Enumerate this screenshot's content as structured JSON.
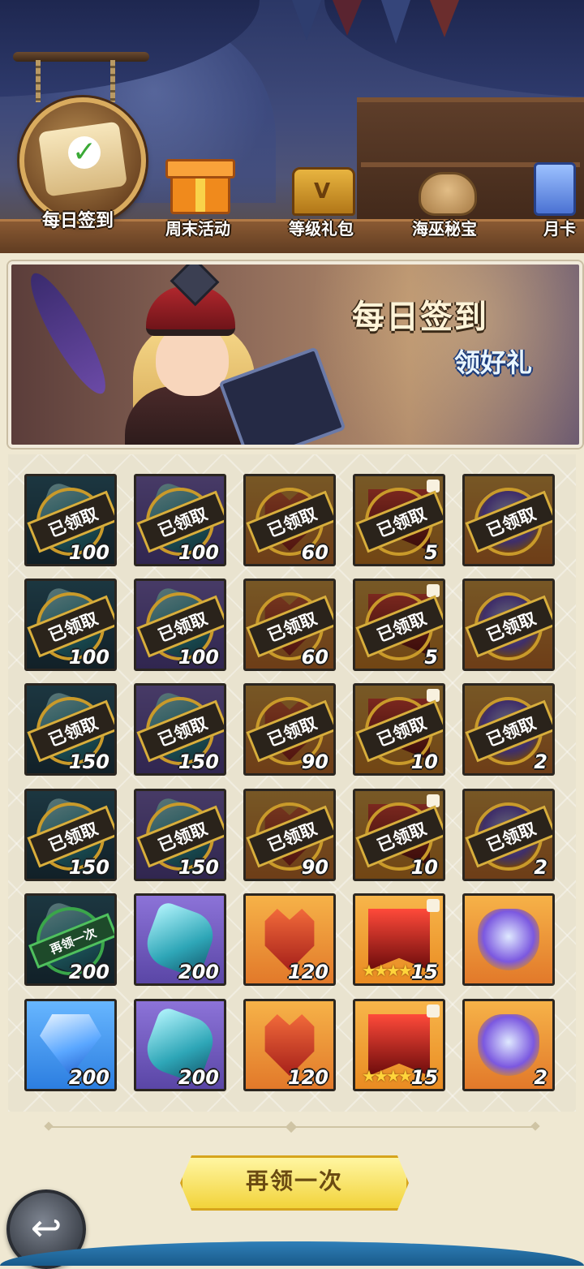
{
  "tabs": [
    {
      "label": "每日签到",
      "icon": "scroll-check-icon",
      "active": true
    },
    {
      "label": "周末活动",
      "icon": "gift-icon",
      "active": false
    },
    {
      "label": "等级礼包",
      "icon": "treasure-chest-icon",
      "active": false
    },
    {
      "label": "海巫秘宝",
      "icon": "treasure-sack-icon",
      "active": false
    },
    {
      "label": "月卡",
      "icon": "card-icon",
      "active": false
    }
  ],
  "banner": {
    "title": "每日签到",
    "subtitle": "领好礼"
  },
  "grid": {
    "claimed_label": "已领取",
    "redo_label": "再领一次",
    "rows": [
      [
        {
          "qty": "100",
          "item": "teal-crystal",
          "bg": "teal",
          "state": "claimed"
        },
        {
          "qty": "100",
          "item": "teal-crystal",
          "bg": "purple",
          "state": "claimed"
        },
        {
          "qty": "60",
          "item": "crown-shield",
          "bg": "orange",
          "state": "claimed"
        },
        {
          "qty": "5",
          "item": "red-banner",
          "bg": "red",
          "state": "claimed"
        },
        {
          "qty": "",
          "item": "relic",
          "bg": "orange",
          "state": "claimed"
        }
      ],
      [
        {
          "qty": "100",
          "item": "teal-crystal",
          "bg": "teal",
          "state": "claimed"
        },
        {
          "qty": "100",
          "item": "teal-crystal",
          "bg": "purple",
          "state": "claimed"
        },
        {
          "qty": "60",
          "item": "crown-shield",
          "bg": "orange",
          "state": "claimed"
        },
        {
          "qty": "5",
          "item": "red-banner",
          "bg": "red",
          "state": "claimed"
        },
        {
          "qty": "",
          "item": "relic",
          "bg": "orange",
          "state": "claimed"
        }
      ],
      [
        {
          "qty": "150",
          "item": "teal-crystal",
          "bg": "teal",
          "state": "claimed"
        },
        {
          "qty": "150",
          "item": "teal-crystal",
          "bg": "purple",
          "state": "claimed"
        },
        {
          "qty": "90",
          "item": "crown-shield",
          "bg": "orange",
          "state": "claimed"
        },
        {
          "qty": "10",
          "item": "red-banner",
          "bg": "red",
          "state": "claimed"
        },
        {
          "qty": "2",
          "item": "relic",
          "bg": "orange",
          "state": "claimed"
        }
      ],
      [
        {
          "qty": "150",
          "item": "teal-crystal",
          "bg": "teal",
          "state": "claimed"
        },
        {
          "qty": "150",
          "item": "teal-crystal",
          "bg": "purple",
          "state": "claimed"
        },
        {
          "qty": "90",
          "item": "crown-shield",
          "bg": "orange",
          "state": "claimed"
        },
        {
          "qty": "10",
          "item": "red-banner",
          "bg": "red",
          "state": "claimed"
        },
        {
          "qty": "2",
          "item": "relic",
          "bg": "orange",
          "state": "claimed"
        }
      ],
      [
        {
          "qty": "200",
          "item": "teal-crystal",
          "bg": "teal",
          "state": "redo"
        },
        {
          "qty": "200",
          "item": "teal-crystal",
          "bg": "purple",
          "state": "open"
        },
        {
          "qty": "120",
          "item": "crown-shield",
          "bg": "orange",
          "state": "open"
        },
        {
          "qty": "15",
          "item": "red-banner",
          "bg": "red",
          "state": "open"
        },
        {
          "qty": "",
          "item": "relic",
          "bg": "orange",
          "state": "open"
        }
      ],
      [
        {
          "qty": "200",
          "item": "blue-diamond",
          "bg": "sky",
          "state": "open"
        },
        {
          "qty": "200",
          "item": "teal-crystal",
          "bg": "purple",
          "state": "open"
        },
        {
          "qty": "120",
          "item": "crown-shield",
          "bg": "orange",
          "state": "open"
        },
        {
          "qty": "15",
          "item": "red-banner",
          "bg": "red",
          "state": "open"
        },
        {
          "qty": "2",
          "item": "relic",
          "bg": "orange",
          "state": "open"
        }
      ]
    ]
  },
  "again_button": "再领一次",
  "back_icon": "back-arrow-icon"
}
